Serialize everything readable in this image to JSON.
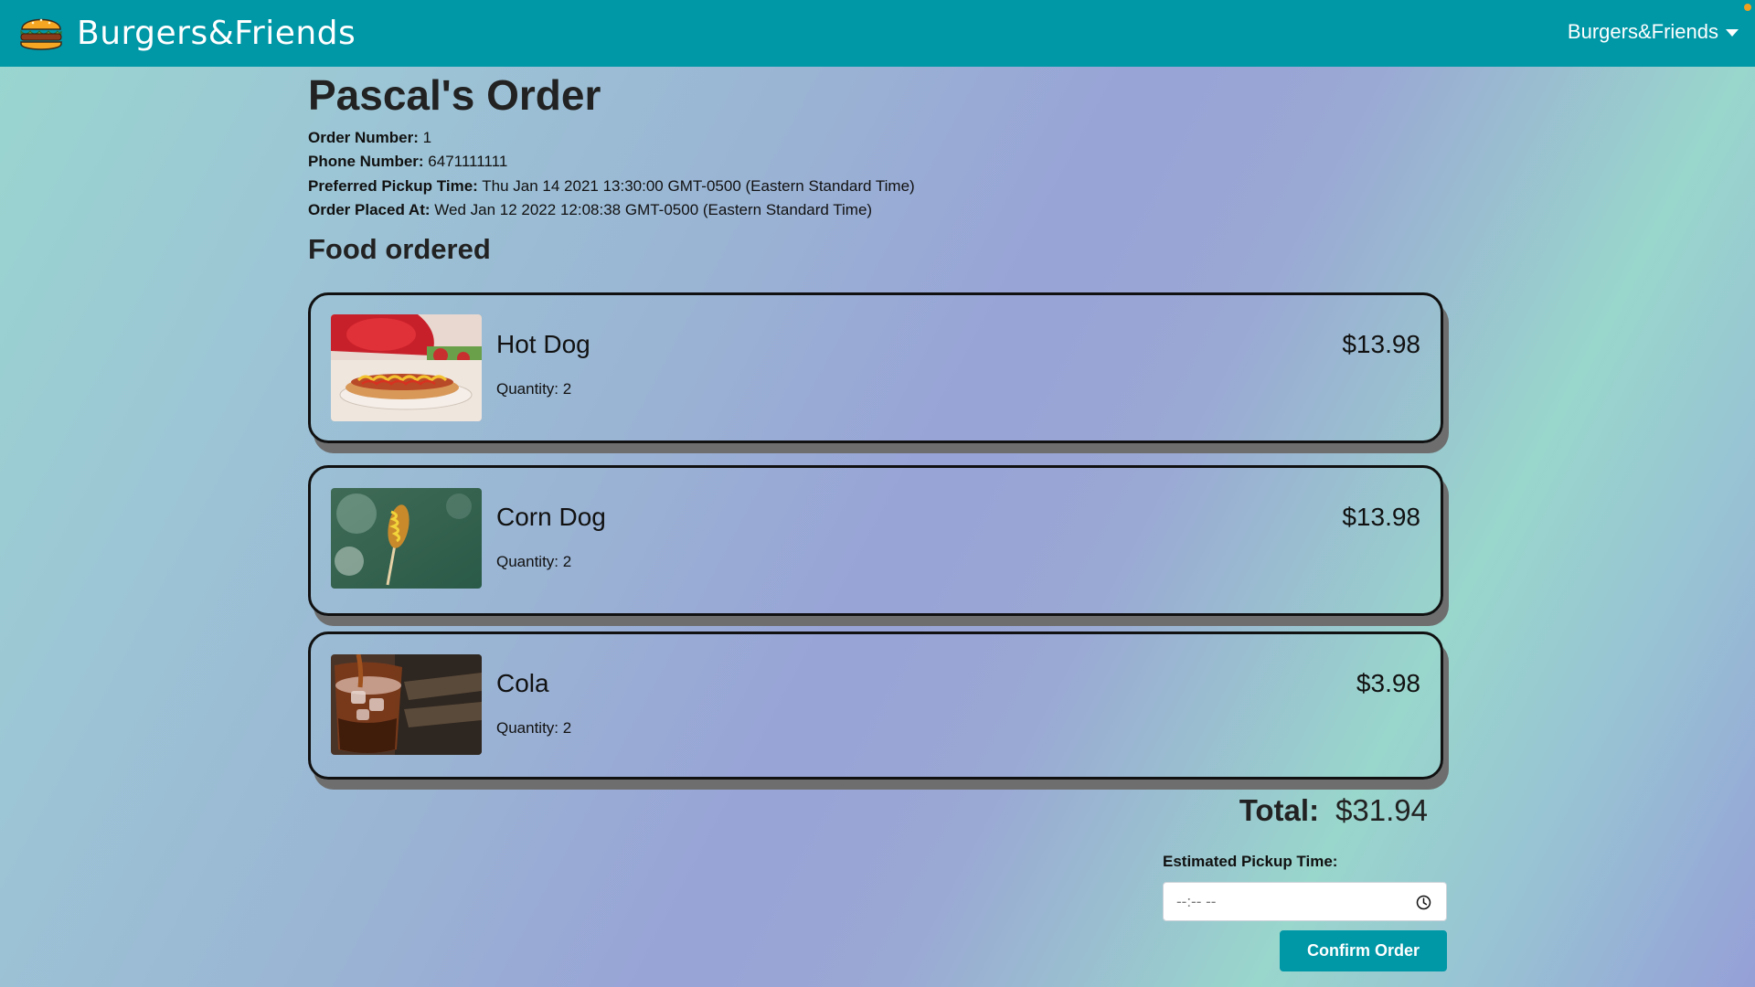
{
  "navbar": {
    "brand": "Burgers&Friends",
    "dropdown_label": "Burgers&Friends",
    "logo_icon": "burger-icon",
    "brand_color": "#0097a7"
  },
  "order": {
    "title": "Pascal's Order",
    "order_number_label": "Order Number:",
    "order_number": "1",
    "phone_label": "Phone Number:",
    "phone": "6471111111",
    "preferred_pickup_label": "Preferred Pickup Time:",
    "preferred_pickup": "Thu Jan 14 2021 13:30:00 GMT-0500 (Eastern Standard Time)",
    "placed_at_label": "Order Placed At:",
    "placed_at": "Wed Jan 12 2022 12:08:38 GMT-0500 (Eastern Standard Time)"
  },
  "food_section_title": "Food ordered",
  "items": [
    {
      "name": "Hot Dog",
      "quantity_text": "Quantity: 2",
      "price": "$13.98",
      "image": "hot-dog-photo"
    },
    {
      "name": "Corn Dog",
      "quantity_text": "Quantity: 2",
      "price": "$13.98",
      "image": "corn-dog-photo"
    },
    {
      "name": "Cola",
      "quantity_text": "Quantity: 2",
      "price": "$3.98",
      "image": "cola-photo"
    }
  ],
  "total": {
    "label": "Total:",
    "value": "$31.94"
  },
  "pickup": {
    "label": "Estimated Pickup Time:",
    "placeholder": "--:-- --",
    "value": ""
  },
  "confirm_label": "Confirm Order"
}
